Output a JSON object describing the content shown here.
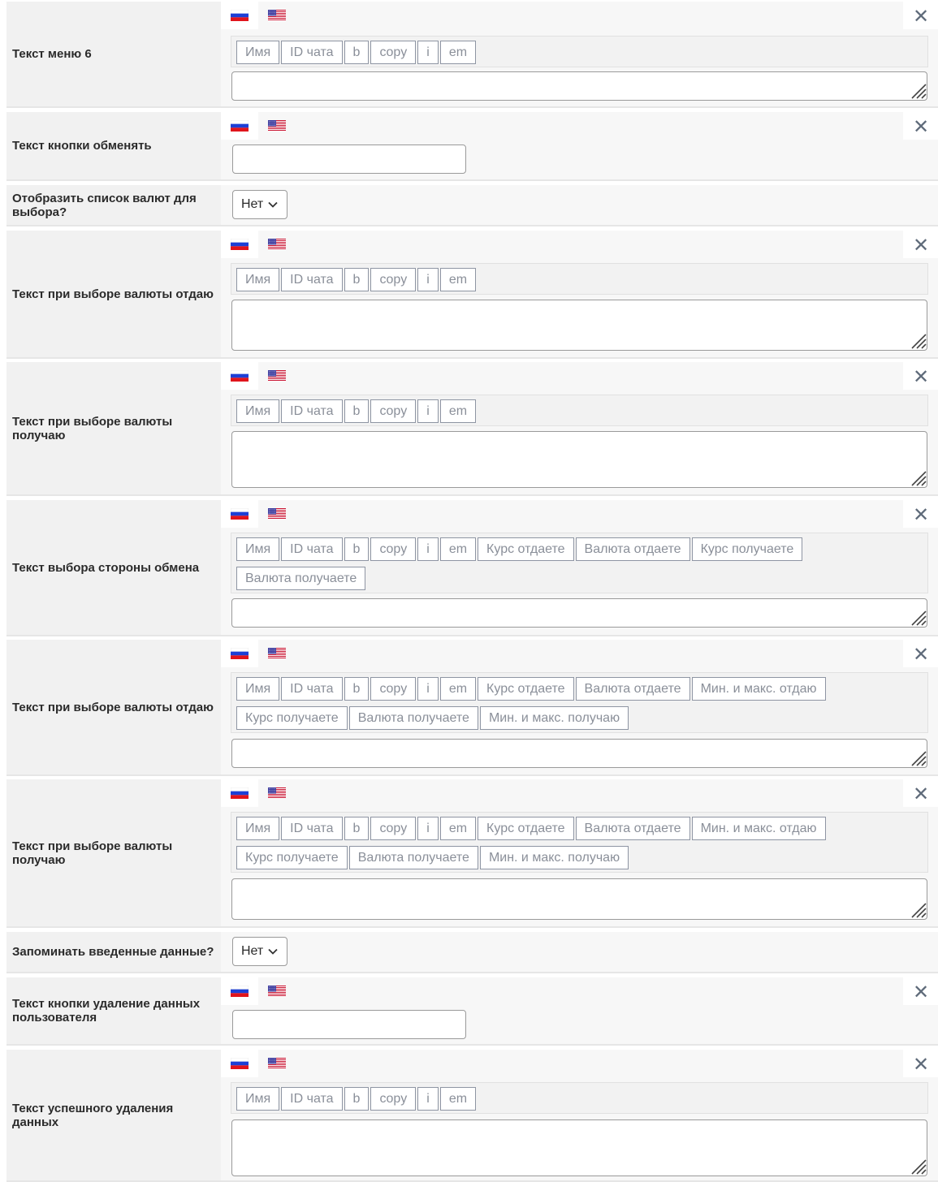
{
  "colors": {
    "label_bg": "#f1f1f1",
    "tag_border": "#8e95a3",
    "close": "#5f6b7a"
  },
  "icons": {
    "ru_flag": "ru-flag-icon",
    "us_flag": "us-flag-icon",
    "close": "close-icon",
    "chevron": "chevron-down-icon"
  },
  "rows": [
    {
      "label": "Текст меню 6",
      "type": "textarea",
      "tags": [
        "Имя",
        "ID чата",
        "b",
        "copy",
        "i",
        "em"
      ]
    },
    {
      "label": "Текст кнопки обменять",
      "type": "input"
    },
    {
      "label": "Отобразить список валют для выбора?",
      "type": "select",
      "value": "Нет"
    },
    {
      "label": "Текст при выборе валюты отдаю",
      "type": "textarea",
      "tags": [
        "Имя",
        "ID чата",
        "b",
        "copy",
        "i",
        "em"
      ]
    },
    {
      "label": "Текст при выборе валюты получаю",
      "type": "textarea",
      "tags": [
        "Имя",
        "ID чата",
        "b",
        "copy",
        "i",
        "em"
      ]
    },
    {
      "label": "Текст выбора стороны обмена",
      "type": "textarea",
      "tags": [
        "Имя",
        "ID чата",
        "b",
        "copy",
        "i",
        "em",
        "Курс отдаете",
        "Валюта отдаете",
        "Курс получаете",
        "Валюта получаете"
      ]
    },
    {
      "label": "Текст при выборе валюты отдаю",
      "type": "textarea",
      "tags": [
        "Имя",
        "ID чата",
        "b",
        "copy",
        "i",
        "em",
        "Курс отдаете",
        "Валюта отдаете",
        "Мин. и макс. отдаю",
        "Курс получаете",
        "Валюта получаете",
        "Мин. и макс. получаю"
      ]
    },
    {
      "label": "Текст при выборе валюты получаю",
      "type": "textarea",
      "tags": [
        "Имя",
        "ID чата",
        "b",
        "copy",
        "i",
        "em",
        "Курс отдаете",
        "Валюта отдаете",
        "Мин. и макс. отдаю",
        "Курс получаете",
        "Валюта получаете",
        "Мин. и макс. получаю"
      ]
    },
    {
      "label": "Запоминать введенные данные?",
      "type": "select",
      "value": "Нет"
    },
    {
      "label": "Текст кнопки удаление данных пользователя",
      "type": "input"
    },
    {
      "label": "Текст успешного удаления данных",
      "type": "textarea",
      "tags": [
        "Имя",
        "ID чата",
        "b",
        "copy",
        "i",
        "em"
      ]
    }
  ]
}
